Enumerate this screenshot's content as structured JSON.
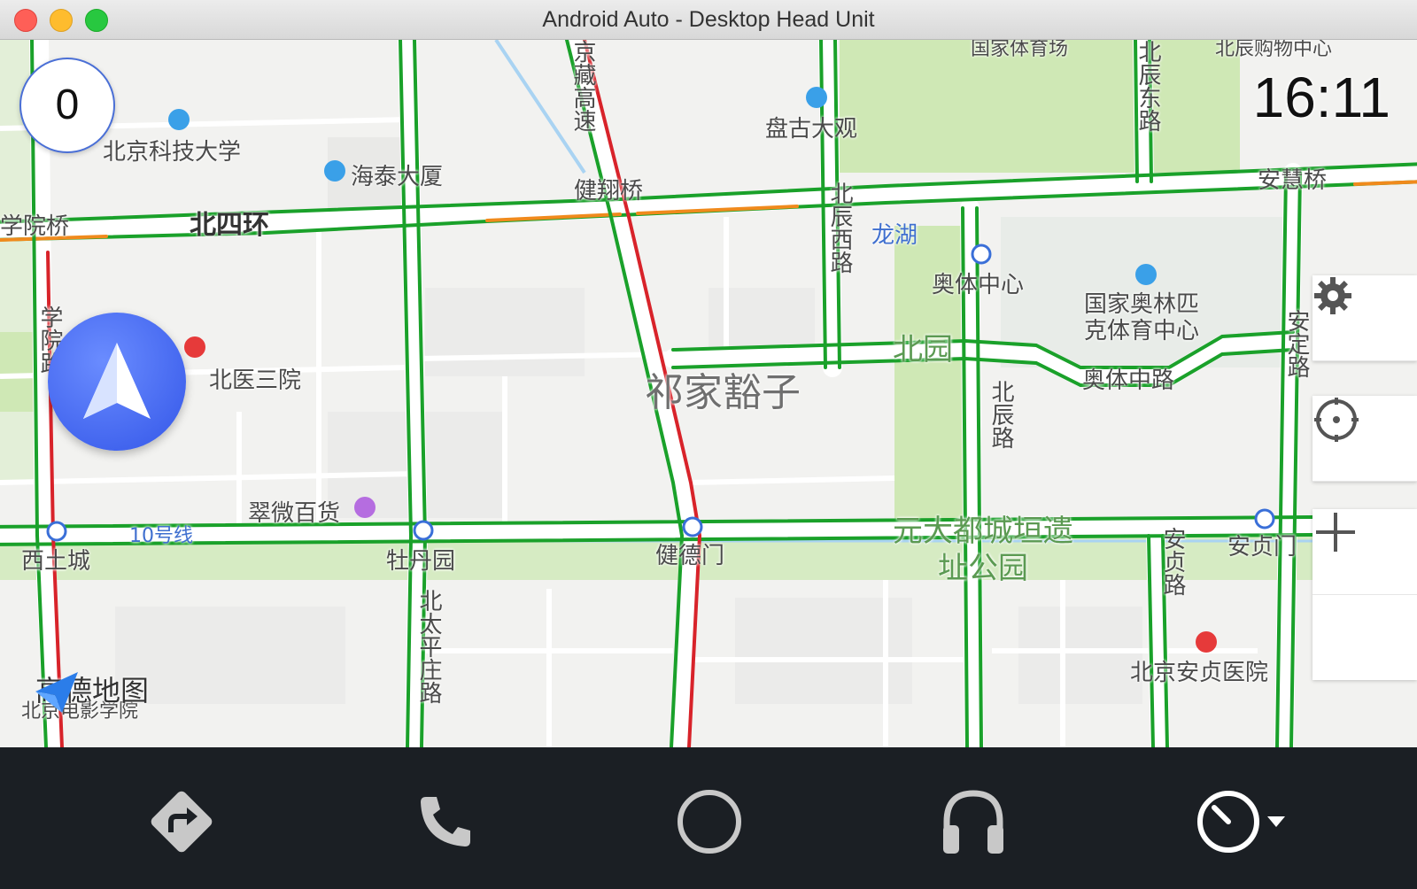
{
  "window": {
    "title": "Android Auto - Desktop Head Unit"
  },
  "map": {
    "speed": "0",
    "clock": "16:11",
    "provider": "高德地图",
    "labels": {
      "area_main": "祁家豁子",
      "ring_road": "北四环",
      "bridge_xueyuan": "学院桥",
      "bridge_jianxiang": "健翔桥",
      "bridge_anhui": "安慧桥",
      "highway": "京藏高速",
      "ustb": "北京科技大学",
      "haitai": "海泰大厦",
      "pangu": "盘古大观",
      "stadium": "国家体育场",
      "shopping": "北辰购物中心",
      "longhu": "龙湖",
      "aoti": "奥体中心",
      "olympic_center": "国家奥林匹克体育中心",
      "beiyuan": "北园",
      "aoti_road": "奥体中路",
      "hospital3": "北医三院",
      "cuiwei": "翠微百货",
      "line10": "10号线",
      "xitucheng": "西土城",
      "mudanyuan": "牡丹园",
      "jiandemen": "健德门",
      "andingmen": "安贞门",
      "park": "元大都城垣遗址公园",
      "anzhen_hospital": "北京安贞医院",
      "film_academy": "北京电影学院",
      "road_beichen_west": "北辰西路",
      "road_beichen": "北辰路",
      "road_beichen_east": "北辰东路",
      "road_anding": "安定路",
      "road_anzhen": "安贞路",
      "road_beitaiping": "北太平庄路",
      "road_xueyuan": "学院路"
    },
    "controls": [
      {
        "name": "settings",
        "icon": "gear-icon"
      },
      {
        "name": "recenter",
        "icon": "locate-icon"
      },
      {
        "name": "zoom-in",
        "icon": "plus-icon"
      },
      {
        "name": "zoom-out",
        "icon": "minus-icon"
      }
    ],
    "colors": {
      "road_green": "#1aa12a",
      "road_red": "#d8232a",
      "road_orange": "#f08a1c",
      "park": "#cfe8b5",
      "nav_blue": "#3f63f0"
    }
  },
  "bottom_bar": {
    "buttons": [
      {
        "name": "navigation",
        "icon": "directions-icon"
      },
      {
        "name": "phone",
        "icon": "phone-icon"
      },
      {
        "name": "home",
        "icon": "home-circle-icon"
      },
      {
        "name": "media",
        "icon": "headphones-icon"
      },
      {
        "name": "dashboard",
        "icon": "speedometer-icon"
      }
    ]
  }
}
